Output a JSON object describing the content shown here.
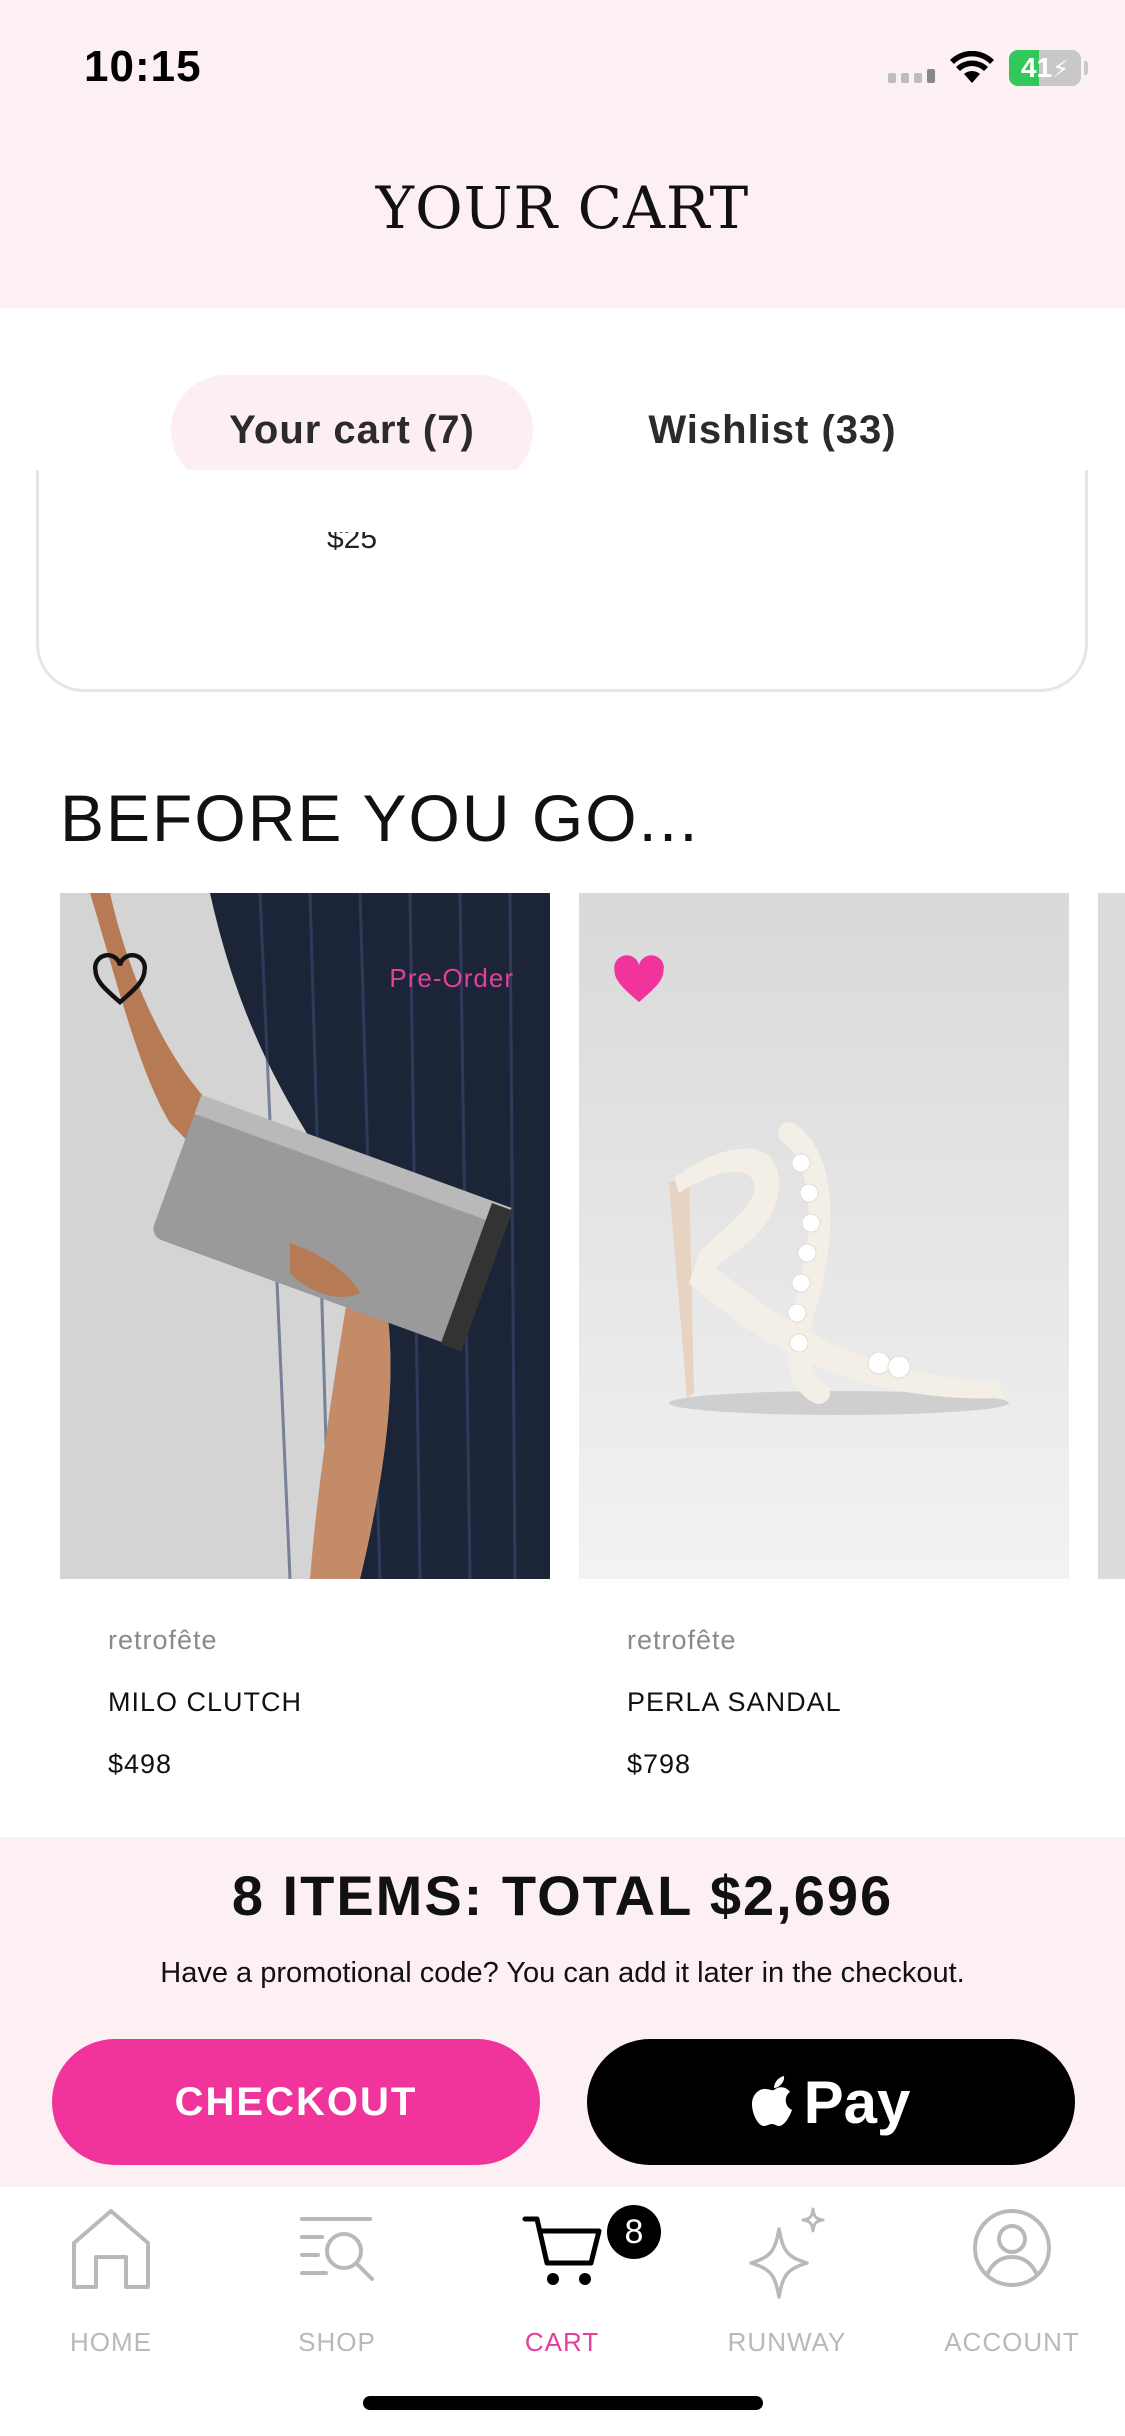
{
  "status_bar": {
    "time": "10:15",
    "battery": "41",
    "battery_level": 0.41,
    "icons": [
      "signal-icon",
      "wifi-icon",
      "battery-charging-icon"
    ]
  },
  "header": {
    "title": "YOUR CART"
  },
  "tabs": [
    {
      "label": "Your cart (7)",
      "active": true
    },
    {
      "label": "Wishlist (33)",
      "active": false
    }
  ],
  "cart_item_partial": {
    "price_fragment": "$25"
  },
  "section": {
    "title": "BEFORE YOU GO..."
  },
  "products": [
    {
      "brand": "retrofête",
      "name": "MILO CLUTCH",
      "price": "$498",
      "badge": "Pre-Order",
      "wishlisted": false,
      "icon": "heart-outline-icon"
    },
    {
      "brand": "retrofête",
      "name": "PERLA SANDAL",
      "price": "$798",
      "badge": "",
      "wishlisted": true,
      "icon": "heart-filled-icon"
    }
  ],
  "summary": {
    "total": "8 ITEMS: TOTAL $2,696",
    "promo": "Have a promotional code? You can add it later in the checkout.",
    "checkout_label": "CHECKOUT",
    "applepay_label": "Pay"
  },
  "tabbar": {
    "items": [
      {
        "label": "HOME",
        "icon": "home-icon",
        "active": false
      },
      {
        "label": "SHOP",
        "icon": "shop-search-icon",
        "active": false
      },
      {
        "label": "CART",
        "icon": "cart-icon",
        "active": true,
        "badge": "8"
      },
      {
        "label": "RUNWAY",
        "icon": "sparkle-icon",
        "active": false
      },
      {
        "label": "ACCOUNT",
        "icon": "account-icon",
        "active": false
      }
    ]
  },
  "colors": {
    "accent_pink": "#f0349c",
    "header_bg": "#fdf0f5",
    "active_tab_bg": "#fdeef4",
    "inactive_icon": "#b9b9b9"
  }
}
